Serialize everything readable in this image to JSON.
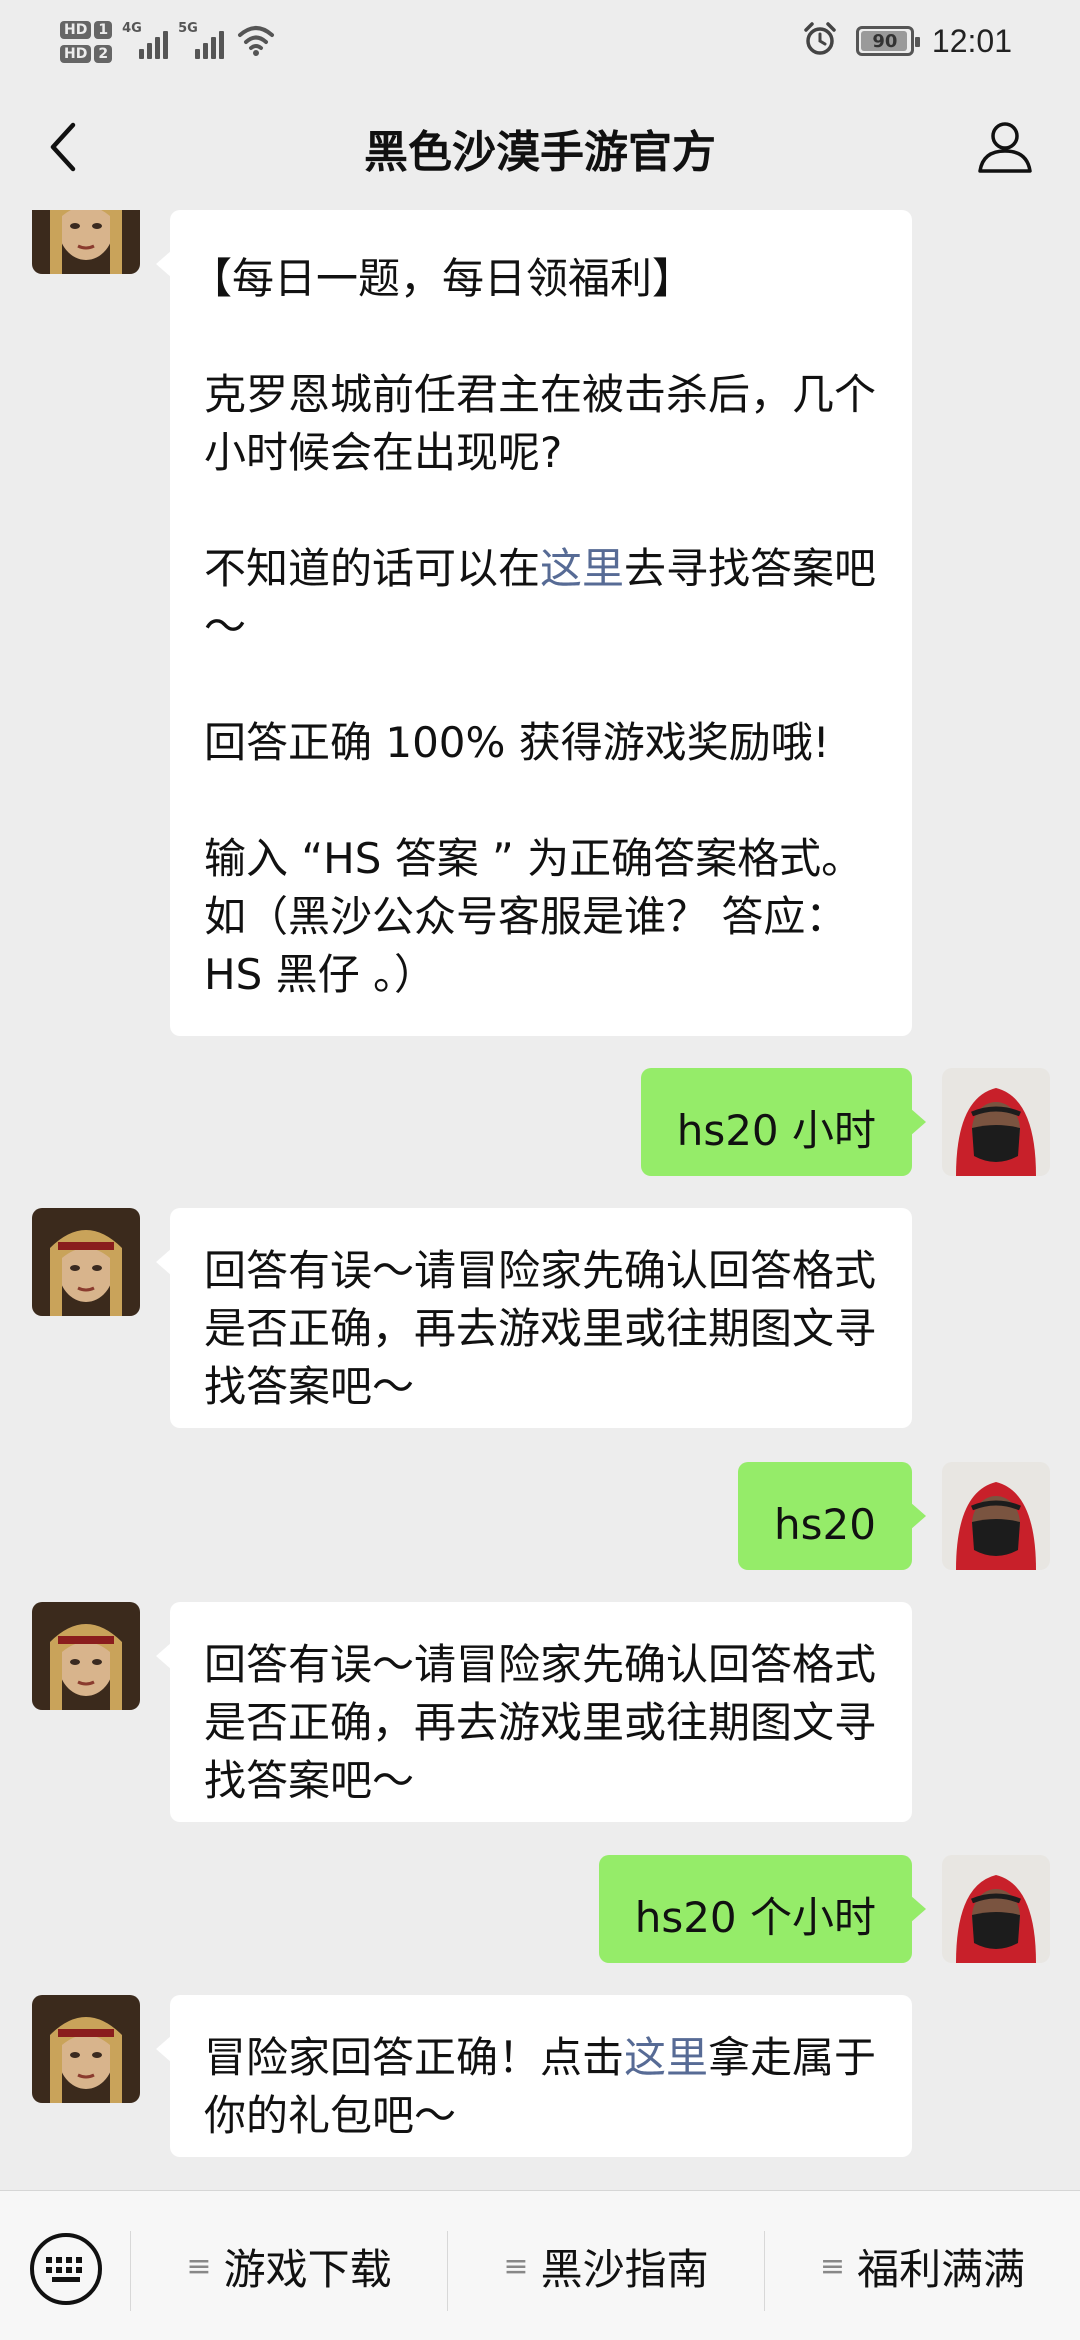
{
  "status_bar": {
    "hd1_label": "HD",
    "hd1_num": "1",
    "hd2_label": "HD",
    "hd2_num": "2",
    "net1": "4G",
    "net2": "5G",
    "battery": "90",
    "time": "12:01"
  },
  "header": {
    "title": "黑色沙漠手游官方"
  },
  "messages": [
    {
      "from": "bot",
      "lines": [
        "【每日一题，每日领福利】",
        "克罗恩城前任君主在被击杀后，几个小时候会在出现呢?",
        "不知道的话可以在",
        "这里",
        "去寻找答案吧～",
        "回答正确 100% 获得游戏奖励哦!",
        "输入 “HS 答案 ” 为正确答案格式。如（黑沙公众号客服是谁？ 答应：HS 黑仔 。）"
      ]
    },
    {
      "from": "me",
      "text": "hs20 小时"
    },
    {
      "from": "bot",
      "text": "回答有误～请冒险家先确认回答格式是否正确，再去游戏里或往期图文寻找答案吧～"
    },
    {
      "from": "me",
      "text": "hs20"
    },
    {
      "from": "bot",
      "text": "回答有误～请冒险家先确认回答格式是否正确，再去游戏里或往期图文寻找答案吧～"
    },
    {
      "from": "me",
      "text": "hs20 个小时"
    },
    {
      "from": "bot",
      "before_link": "冒险家回答正确！点击",
      "link": "这里",
      "after_link": "拿走属于你的礼包吧～"
    }
  ],
  "bottom_menu": {
    "items": [
      {
        "label": "游戏下载"
      },
      {
        "label": "黑沙指南"
      },
      {
        "label": "福利满满"
      }
    ],
    "menu_icon": "≡"
  },
  "colors": {
    "background": "#ededed",
    "outgoing_bubble": "#95ec69",
    "incoming_bubble": "#ffffff",
    "link": "#576b95"
  },
  "icons": {
    "back": "chevron-left-icon",
    "profile": "user-icon",
    "keyboard": "keyboard-icon",
    "alarm": "alarm-icon",
    "wifi": "wifi-icon"
  }
}
